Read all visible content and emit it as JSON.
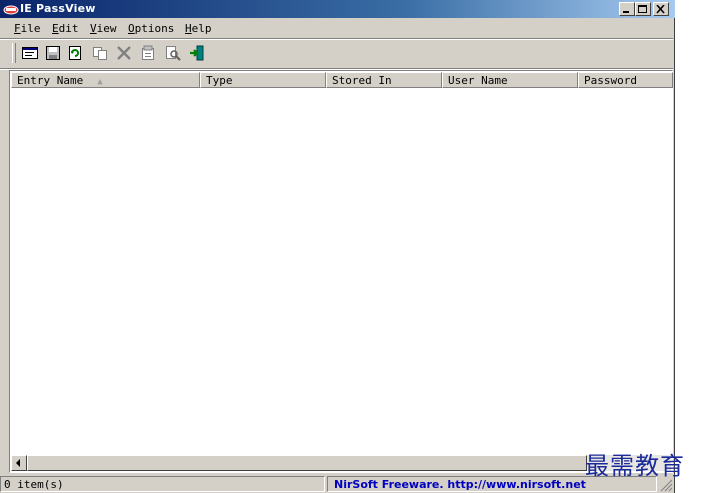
{
  "window": {
    "title": "IE PassView"
  },
  "menu": [
    {
      "label": "File",
      "key": "F",
      "rest": "ile"
    },
    {
      "label": "Edit",
      "key": "E",
      "rest": "dit"
    },
    {
      "label": "View",
      "key": "V",
      "rest": "iew"
    },
    {
      "label": "Options",
      "key": "O",
      "rest": "ptions"
    },
    {
      "label": "Help",
      "key": "H",
      "rest": "elp"
    }
  ],
  "toolbar": {
    "icons": [
      "properties-icon",
      "save-icon",
      "refresh-icon",
      "copy-icon",
      "delete-icon",
      "report-icon",
      "find-icon",
      "exit-icon"
    ]
  },
  "columns": [
    "Entry Name",
    "Type",
    "Stored In",
    "User Name",
    "Password"
  ],
  "rows": [],
  "status": {
    "count": "0 item(s)",
    "credit": "NirSoft Freeware.  http://www.nirsoft.net"
  },
  "watermark": "最需教育",
  "colors": {
    "titlebar": "#0a246a",
    "link": "#0000c0",
    "face": "#d4d0c8"
  }
}
